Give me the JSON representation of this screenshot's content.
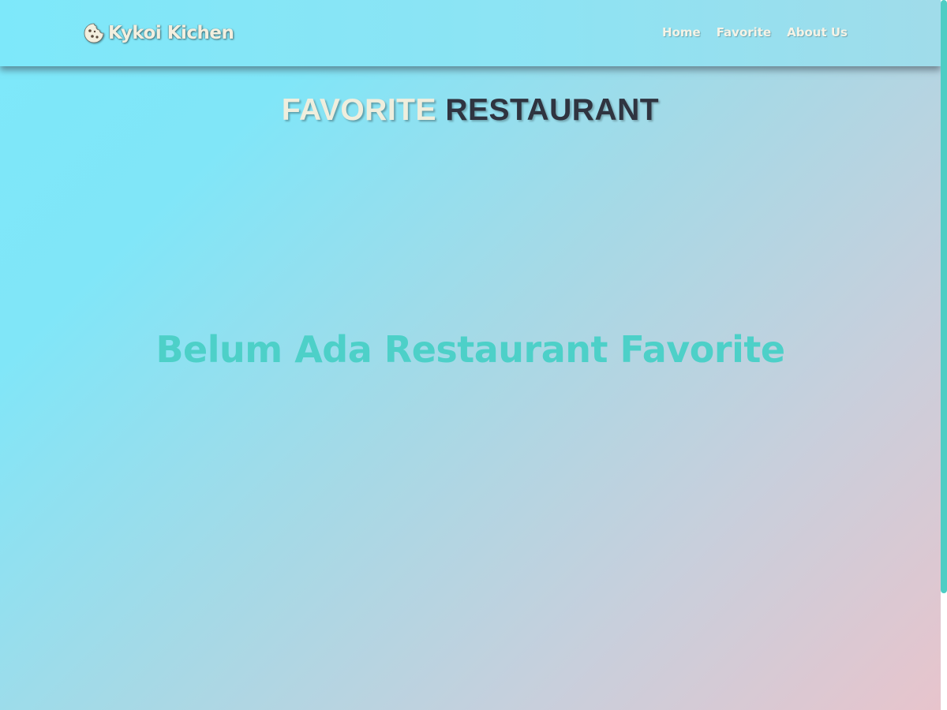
{
  "header": {
    "brand_name": "Kykoi Kichen",
    "brand_icon": "cookie-icon",
    "nav": [
      {
        "label": "Home"
      },
      {
        "label": "Favorite"
      },
      {
        "label": "About Us"
      }
    ]
  },
  "main": {
    "title_part_1": "FAVORITE",
    "title_part_2": "RESTAURANT",
    "empty_message": "Belum Ada Restaurant Favorite"
  },
  "colors": {
    "background_start": "#7de8fa",
    "background_end": "#e8c4cc",
    "accent": "#4ecdc4",
    "title_light": "#efeedd",
    "title_dark": "#2f3440"
  }
}
